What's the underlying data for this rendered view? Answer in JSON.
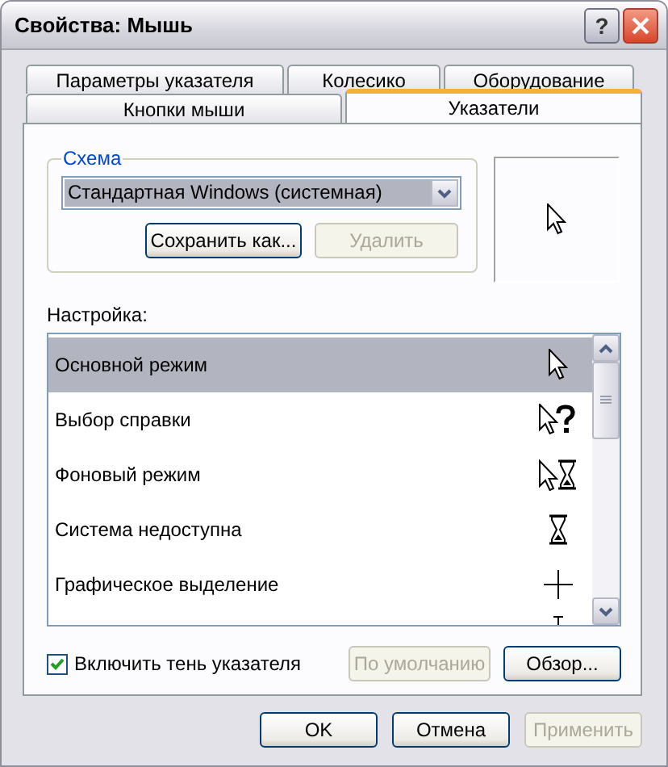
{
  "window": {
    "title": "Свойства: Мышь",
    "help_button": "?"
  },
  "tab_rows": [
    {
      "tabs": [
        {
          "label": "Параметры указателя",
          "selected": false
        },
        {
          "label": "Колесико",
          "selected": false
        },
        {
          "label": "Оборудование",
          "selected": false
        }
      ]
    },
    {
      "tabs": [
        {
          "label": "Кнопки мыши",
          "selected": false
        },
        {
          "label": "Указатели",
          "selected": true
        }
      ]
    }
  ],
  "scheme": {
    "label": "Схема",
    "value": "Стандартная Windows (системная)",
    "buttons": [
      {
        "label": "Сохранить как...",
        "disabled": false
      },
      {
        "label": "Удалить",
        "disabled": true
      }
    ]
  },
  "customize": {
    "label": "Настройка:",
    "items": [
      {
        "label": "Основной режим",
        "kind": "arrow",
        "selected": true
      },
      {
        "label": "Выбор справки",
        "kind": "help",
        "selected": false
      },
      {
        "label": "Фоновый режим",
        "kind": "busy",
        "selected": false
      },
      {
        "label": "Система недоступна",
        "kind": "wait",
        "selected": false
      },
      {
        "label": "Графическое выделение",
        "kind": "cross",
        "selected": false
      },
      {
        "kind": "text",
        "selected": false
      }
    ]
  },
  "shadow": {
    "label": "Включить тень указателя",
    "checked": true
  },
  "list_buttons": [
    {
      "label": "По умолчанию",
      "disabled": true
    },
    {
      "label": "Обзор...",
      "disabled": false
    }
  ],
  "dialog_buttons": [
    {
      "label": "OK",
      "disabled": false
    },
    {
      "label": "Отмена",
      "disabled": false
    },
    {
      "label": "Применить",
      "disabled": true
    }
  ]
}
